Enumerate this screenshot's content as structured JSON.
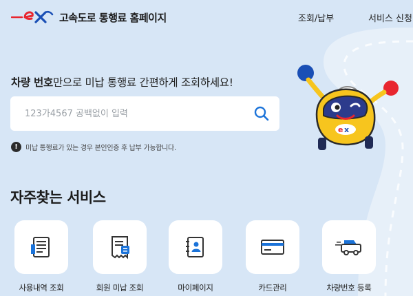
{
  "header": {
    "logo_text": "ex",
    "site_title": "고속도로 통행료 홈페이지",
    "nav": [
      {
        "label": "조회/납부",
        "icon": ""
      },
      {
        "label": "서비스 신청",
        "icon": ""
      }
    ]
  },
  "hero": {
    "headline_bold": "차량 번호",
    "headline_rest": "만으로 미납 통행료 간편하게 조회하세요!",
    "search_placeholder": "123가4567 공백없이 입력",
    "search_value": "",
    "search_icon": "search-icon",
    "notice_icon_glyph": "!",
    "notice_text": "미납 통행료가 있는 경우 본인인증 후 납부 가능합니다."
  },
  "services": {
    "title": "자주찾는 서비스",
    "items": [
      {
        "label": "사용내역 조회",
        "icon": "document-list-icon"
      },
      {
        "label": "회원 미납 조회",
        "icon": "receipt-icon"
      },
      {
        "label": "마이페이지",
        "icon": "profile-book-icon"
      },
      {
        "label": "카드관리",
        "icon": "credit-card-icon"
      },
      {
        "label": "차량번호 등록",
        "icon": "car-icon"
      }
    ]
  },
  "colors": {
    "background": "#d7e6f6",
    "brand_red": "#e8262f",
    "brand_blue": "#1a4fb5",
    "accent_blue": "#1b73d9",
    "card": "#ffffff"
  }
}
